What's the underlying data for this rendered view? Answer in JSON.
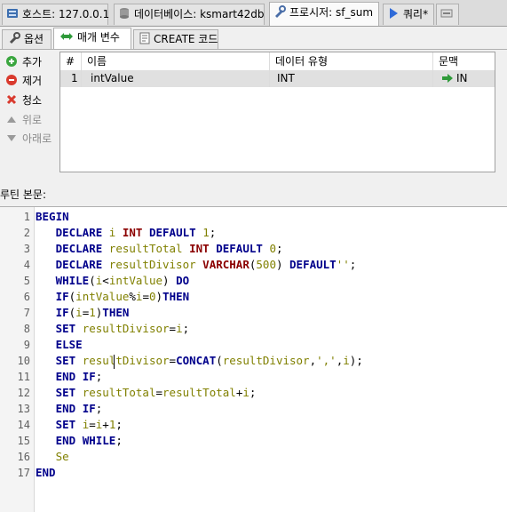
{
  "tabs": [
    {
      "label": "호스트: 127.0.0.1",
      "icon": "server-icon"
    },
    {
      "label": "데이터베이스: ksmart42db",
      "icon": "database-icon"
    },
    {
      "label": "프로시저: sf_sum",
      "icon": "procedure-icon"
    },
    {
      "label": "쿼리*",
      "icon": "play-icon"
    }
  ],
  "subtabs": [
    {
      "label": "옵션",
      "icon": "wrench-icon"
    },
    {
      "label": "매개 변수",
      "icon": "arrows-icon"
    },
    {
      "label": "CREATE 코드",
      "icon": "document-icon"
    }
  ],
  "actions": {
    "add": "추가",
    "remove": "제거",
    "clear": "청소",
    "up": "위로",
    "down": "아래로"
  },
  "params_table": {
    "headers": [
      "#",
      "이름",
      "데이터 유형",
      "문맥"
    ],
    "rows": [
      {
        "num": "1",
        "name": "intValue",
        "type": "INT",
        "context": "IN"
      }
    ]
  },
  "routine_label": "루틴 본문:",
  "code_lines": [
    "1",
    "2",
    "3",
    "4",
    "5",
    "6",
    "7",
    "8",
    "9",
    "10",
    "11",
    "12",
    "13",
    "14",
    "15",
    "16",
    "17"
  ],
  "colors": {
    "keyword": "#00008b",
    "type": "#8b0000",
    "identifier": "#808000"
  }
}
